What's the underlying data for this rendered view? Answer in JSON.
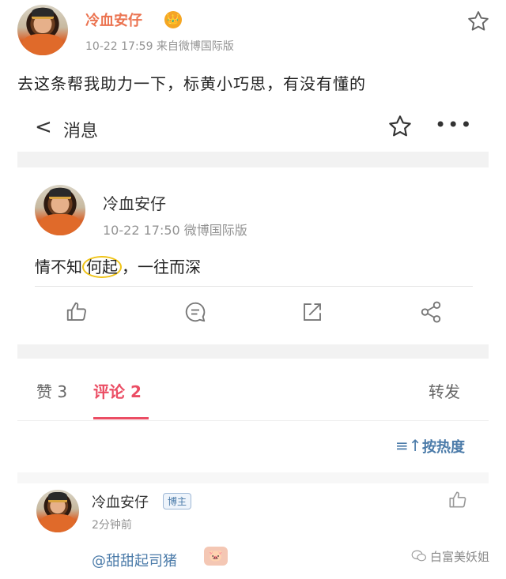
{
  "outer_post": {
    "author": "冷血安仔",
    "crown_glyph": "👑",
    "meta": "10-22 17:59  来自微博国际版",
    "text": "去这条帮我助力一下，标黄小巧思，有没有懂的"
  },
  "nav": {
    "back_glyph": "<",
    "title": "消息",
    "more_glyph": "•••"
  },
  "inner_post": {
    "author": "冷血安仔",
    "meta": "10-22 17:50  微博国际版",
    "text_before": "情不知",
    "text_highlight": "何起",
    "text_after": "，一往而深"
  },
  "tabs": {
    "likes": "赞 3",
    "comments": "评论 2",
    "repost": "转发"
  },
  "sort": {
    "icon_glyph": "≡↑",
    "label": "按热度"
  },
  "comment": {
    "author": "冷血安仔",
    "badge": "博主",
    "time": "2分钟前",
    "text": "@甜甜起司猪"
  },
  "watermark": {
    "text": "白富美妖姐"
  },
  "colors": {
    "author_orange": "#eb7350",
    "accent_red": "#eb4d64",
    "link_blue": "#4b7ba9",
    "meta_gray": "#939393",
    "highlight_yellow": "#f0c419"
  }
}
